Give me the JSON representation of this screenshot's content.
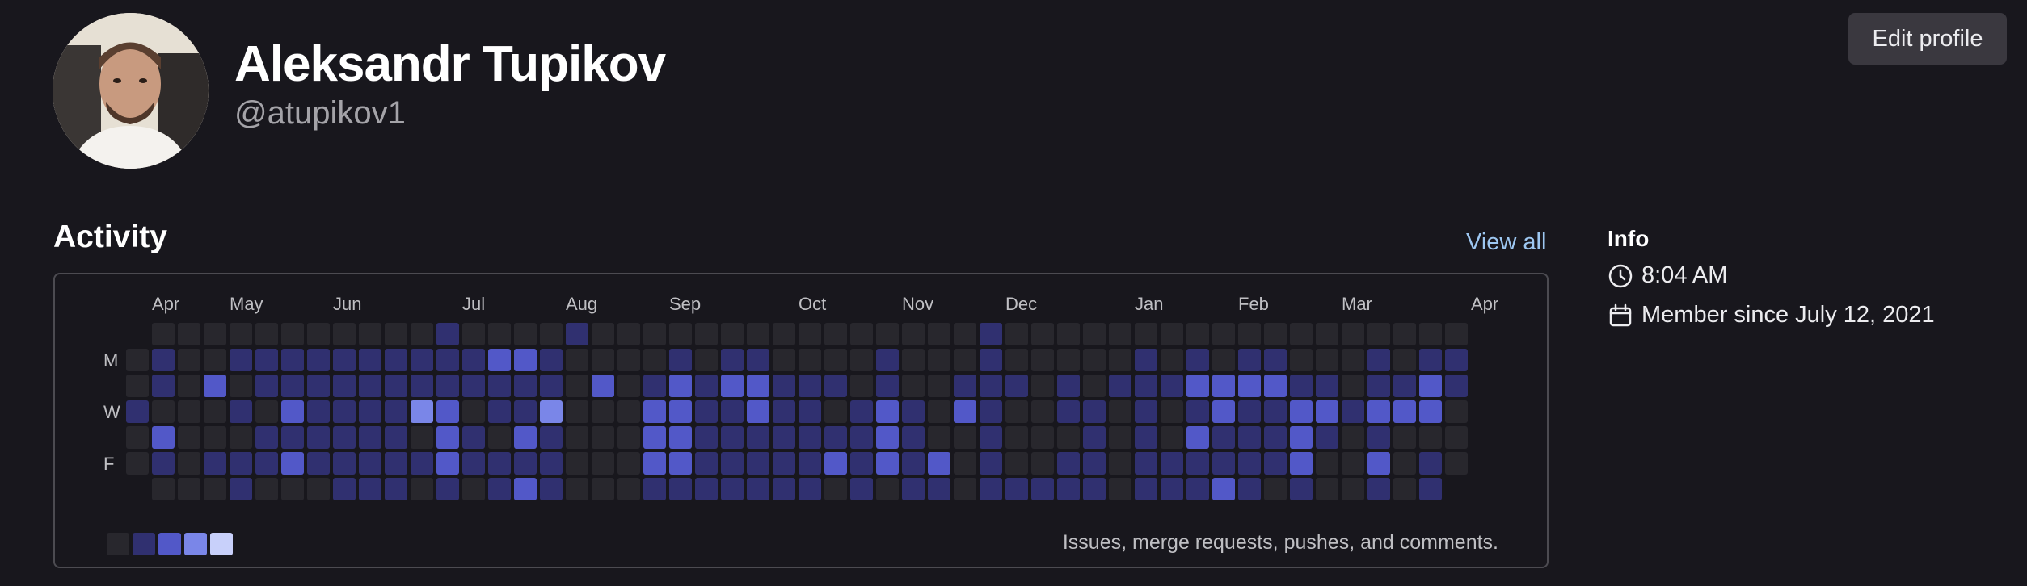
{
  "profile": {
    "name": "Aleksandr Tupikov",
    "username": "@atupikov1",
    "edit_label": "Edit profile"
  },
  "activity": {
    "title": "Activity",
    "view_all": "View all",
    "months": [
      "Apr",
      "May",
      "Jun",
      "Jul",
      "Aug",
      "Sep",
      "Oct",
      "Nov",
      "Dec",
      "Jan",
      "Feb",
      "Mar",
      "Apr"
    ],
    "month_weeks": [
      1,
      4,
      8,
      13,
      17,
      21,
      26,
      30,
      34,
      39,
      43,
      47,
      52
    ],
    "day_labels": [
      {
        "row": 1,
        "label": "M"
      },
      {
        "row": 3,
        "label": "W"
      },
      {
        "row": 5,
        "label": "F"
      }
    ],
    "caption": "Issues, merge requests, pushes, and comments.",
    "level_colors": [
      "#28272d",
      "#303070",
      "#5258c8",
      "#7a86e8",
      "#c8d0fa"
    ],
    "empty_color": "#28272d",
    "weeks": [
      "-00100-",
      "0110210",
      "0000000",
      "0020010",
      "0101011",
      "0110110",
      "0112120",
      "0111110",
      "0111111",
      "0111111",
      "0111111",
      "0113010",
      "1112221",
      "0110110",
      "0211011",
      "0211212",
      "0113111",
      "1000000",
      "0020000",
      "0000000",
      "0012221",
      "0122221",
      "0011111",
      "0121111",
      "0122111",
      "0011111",
      "0011111",
      "0010120",
      "0001111",
      "0112220",
      "0001111",
      "0000021",
      "0012000",
      "1111111",
      "0010001",
      "0000001",
      "0011011",
      "0001111",
      "0010000",
      "0111111",
      "0010011",
      "0121211",
      "0022112",
      "0121111",
      "0121110",
      "0012221",
      "0012100",
      "0001000",
      "0112121",
      "0012000",
      "0122011",
      "011000-"
    ]
  },
  "info": {
    "title": "Info",
    "time": "8:04 AM",
    "member_since": "Member since July 12, 2021",
    "icons": {
      "time": "clock-icon",
      "member": "calendar-icon"
    }
  }
}
